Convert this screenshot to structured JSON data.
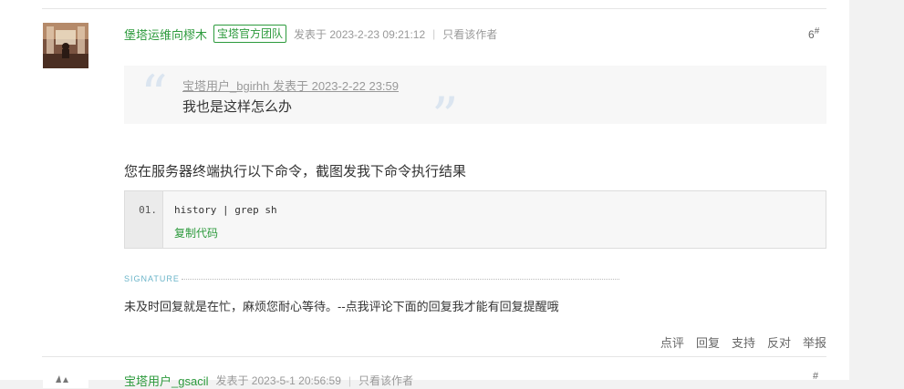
{
  "post": {
    "username": "堡塔运维向樛木",
    "badge": "宝塔官方团队",
    "posted_at": "发表于 2023-2-23 09:21:12",
    "separator": "|",
    "only_author": "只看该作者",
    "floor_num": "6",
    "floor_mark": "#",
    "quote": {
      "open_mark": "“",
      "close_mark": "”",
      "header": "宝塔用户_bgirhh 发表于 2023-2-22 23:59",
      "text": "我也是这样怎么办"
    },
    "content": "您在服务器终端执行以下命令，截图发我下命令执行结果",
    "code": {
      "line_number": "01.",
      "line": "history | grep sh",
      "copy_label": "复制代码"
    },
    "signature_label": "SIGNATURE",
    "signature_text": "未及时回复就是在忙，麻烦您耐心等待。--点我评论下面的回复我才能有回复提醒哦",
    "actions": [
      "点评",
      "回复",
      "支持",
      "反对",
      "举报"
    ]
  },
  "next_post": {
    "username": "宝塔用户_gsacil",
    "posted_at": "发表于 2023-5-1 20:56:59",
    "separator": "|",
    "only_author": "只看该作者",
    "floor_mark": "#"
  },
  "colors": {
    "accent": "#2c9a3c",
    "signature": "#6bb5c9",
    "quote_mark": "#dbe5f0"
  }
}
